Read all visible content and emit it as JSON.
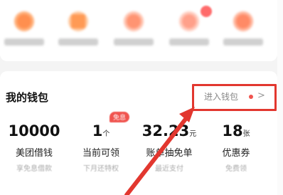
{
  "shortcuts": [
    {
      "icon": "shortcut-icon",
      "color": "#ffb07a"
    },
    {
      "icon": "shortcut-icon",
      "color": "#ffb27c"
    },
    {
      "icon": "shortcut-icon",
      "color": "#ffa88c"
    },
    {
      "icon": "shortcut-icon",
      "color": "#ffb6a0"
    },
    {
      "icon": "shortcut-icon",
      "color": "#ff9d7a"
    }
  ],
  "wallet": {
    "title": "我的钱包",
    "enter_label": "进入钱包",
    "chevron": ">",
    "highlight_color": "#e2372f"
  },
  "stats": [
    {
      "value": "10000",
      "unit": "",
      "label": "美团借钱",
      "sub": "享免息借款"
    },
    {
      "value": "1",
      "unit": "个",
      "label": "当前可领",
      "sub": "下月还特权",
      "badge": "免息"
    },
    {
      "value": "32.23",
      "unit": "元",
      "label": "账单抽免单",
      "sub": "最近支付"
    },
    {
      "value": "18",
      "unit": "张",
      "label": "优惠券",
      "sub": "免费领"
    }
  ]
}
